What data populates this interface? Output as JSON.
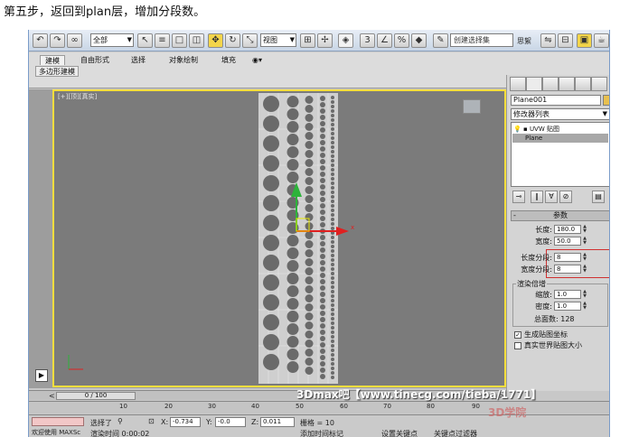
{
  "caption": "第五步，返回到plan层，增加分段数。",
  "toolbar": {
    "selection_filter": "全部",
    "view_dropdown": "视图",
    "named_selection_placeholder": "创建选择集",
    "extra_text": "思絮"
  },
  "ribbon": {
    "tabs": [
      "建模",
      "自由形式",
      "选择",
      "对象绘制",
      "填充"
    ],
    "subtab": "多边形建模"
  },
  "viewport": {
    "label": "[+][顶][真实]",
    "axis_x_label": "x"
  },
  "command_panel": {
    "object_name": "Plane001",
    "modifier_list": "修改器列表",
    "stack": {
      "uvw": "UVW 贴图",
      "plane": "Plane"
    },
    "params_title": "参数",
    "length_label": "长度:",
    "length_value": "180.0",
    "width_label": "宽度:",
    "width_value": "50.0",
    "length_segs_label": "长度分段:",
    "length_segs_value": "8",
    "width_segs_label": "宽度分段:",
    "width_segs_value": "8",
    "render_mult_title": "渲染倍增",
    "scale_label": "缩放:",
    "scale_value": "1.0",
    "density_label": "密度:",
    "density_value": "1.0",
    "total_faces": "总面数: 128",
    "gen_mapping": "生成贴图坐标",
    "real_world": "真实世界贴图大小"
  },
  "timeline": {
    "slider": "0 / 100",
    "ticks": [
      "10",
      "20",
      "30",
      "40",
      "50",
      "60",
      "70",
      "80",
      "90"
    ]
  },
  "status": {
    "welcome": "欢迎使用 MAXSc",
    "selected": "选择了",
    "x_label": "X:",
    "x_value": "-0.734",
    "y_label": "Y:",
    "y_value": "-0.0",
    "z_label": "Z:",
    "z_value": "0.011",
    "grid": "栅格 = 10",
    "add_time": "添加时间标记",
    "set_key": "设置关键点",
    "key_filter": "关键点过滤器",
    "render_time": "渲染时间 0:00:02"
  },
  "watermark": "3Dmax吧【www.tinecg.com/tieba/1771】",
  "watermark_corner": "3D学院"
}
